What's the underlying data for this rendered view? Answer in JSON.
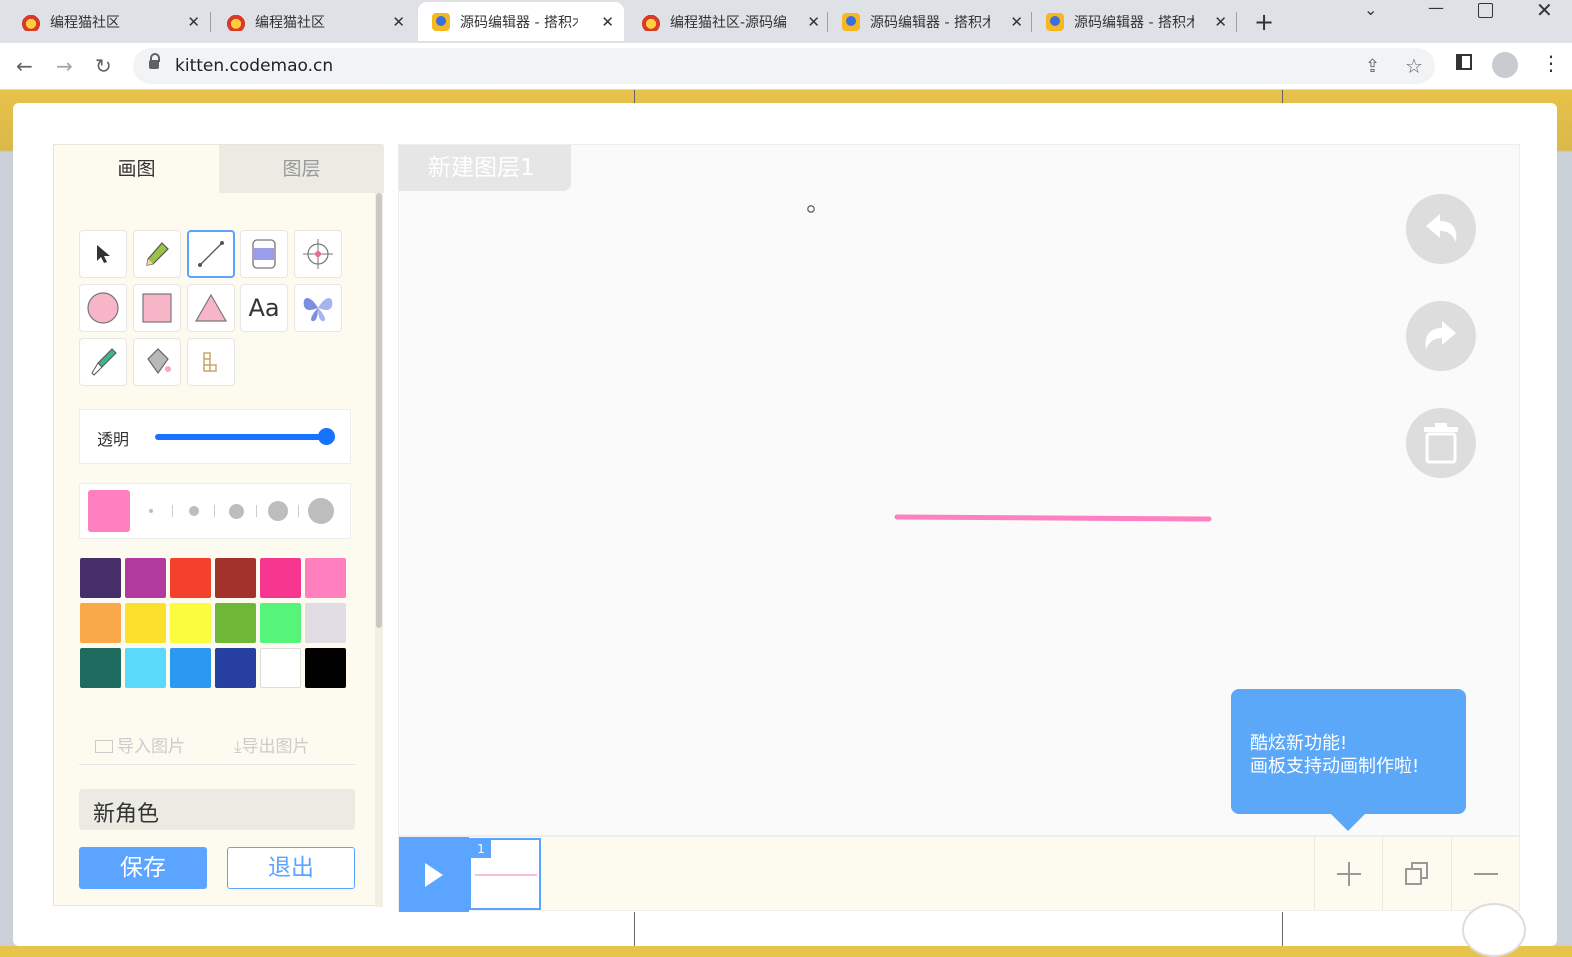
{
  "browser": {
    "tabs": [
      {
        "title": "编程猫社区",
        "favicon": "codemao-cat-icon",
        "active": false
      },
      {
        "title": "编程猫社区",
        "favicon": "codemao-cat-icon",
        "active": false
      },
      {
        "title": "源码编辑器 - 搭积木",
        "favicon": "source-editor-icon",
        "active": true
      },
      {
        "title": "编程猫社区-源码编",
        "favicon": "codemao-cat-icon",
        "active": false
      },
      {
        "title": "源码编辑器 - 搭积木",
        "favicon": "source-editor-icon",
        "active": false
      },
      {
        "title": "源码编辑器 - 搭积木",
        "favicon": "source-editor-icon",
        "active": false
      }
    ],
    "url": "kitten.codemao.cn"
  },
  "panel": {
    "tab_draw": "画图",
    "tab_layers": "图层",
    "tools": [
      "select",
      "pencil",
      "line",
      "eraser",
      "center",
      "circle",
      "rectangle",
      "triangle",
      "text",
      "butterfly",
      "eyedropper",
      "fill",
      "blocks"
    ],
    "text_tool_label": "Aa",
    "selected_tool": "line",
    "opacity_label": "透明",
    "opacity_value": 1.0,
    "current_color": "#ff80c0",
    "palette": [
      "#452e6a",
      "#b03a9e",
      "#f4412b",
      "#a3332a",
      "#f7368f",
      "#ff7fbf",
      "#faa94a",
      "#fbe12c",
      "#fbfc3e",
      "#6fb736",
      "#57f47a",
      "#e0dce3",
      "#1e6c5f",
      "#5ad9fb",
      "#2b99f1",
      "#273fa0",
      "#ffffff",
      "#000000"
    ],
    "import_label": "导入图片",
    "export_label": "导出图片",
    "sprite_name": "新角色",
    "save_label": "保存",
    "exit_label": "退出"
  },
  "canvas": {
    "layer_name": "新建图层1",
    "stroke_color": "#ff80c0",
    "tooltip_line1": "酷炫新功能!",
    "tooltip_line2": "画板支持动画制作啦!"
  },
  "timeline": {
    "frame_number": "1"
  }
}
